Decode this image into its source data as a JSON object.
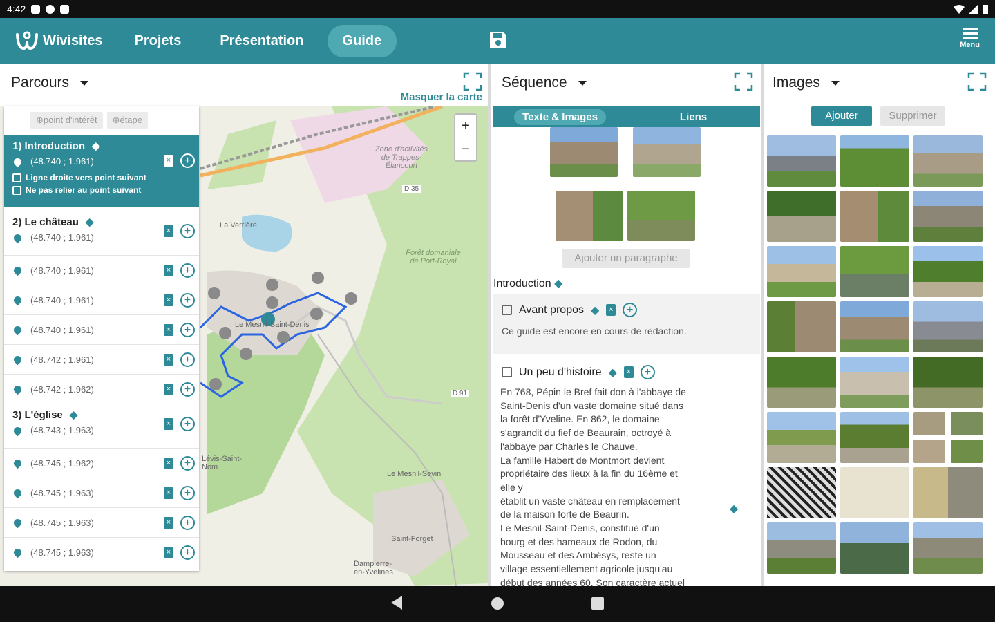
{
  "status_bar": {
    "time": "4:42"
  },
  "app_bar": {
    "logo": "Wivisites",
    "nav": [
      "Projets",
      "Présentation",
      "Guide"
    ],
    "active_nav": "Guide",
    "menu_label": "Menu"
  },
  "parcours": {
    "title": "Parcours",
    "hide_map": "Masquer la carte",
    "add_poi": "point d'intérêt",
    "add_step": "étape",
    "zoom_in": "+",
    "zoom_out": "−",
    "steps": [
      {
        "title": "1) Introduction",
        "coord": "(48.740 ; 1.961)",
        "opt1": "Ligne droite vers point suivant",
        "opt2": "Ne pas relier au point suivant"
      },
      {
        "title": "2) Le château",
        "coord": "(48.740 ; 1.961)"
      },
      {
        "title": "3) L'église",
        "coord": "(48.743 ; 1.963)"
      }
    ],
    "points_after_2": [
      "(48.740 ; 1.961)",
      "(48.740 ; 1.961)",
      "(48.740 ; 1.961)",
      "(48.742 ; 1.961)",
      "(48.742 ; 1.962)"
    ],
    "points_after_3": [
      "(48.745 ; 1.962)",
      "(48.745 ; 1.963)",
      "(48.745 ; 1.963)",
      "(48.745 ; 1.963)"
    ],
    "map_labels": [
      "Zone d'activités de Trappes-Élancourt",
      "Forêt domaniale de Port-Royal",
      "Le Mesnil-Saint-Denis",
      "Le Mesnil-Sevin",
      "Saint-Forget",
      "Dampierre-en-Yvelines",
      "Lévis-Saint-Nom",
      "La Verrière",
      "D 91",
      "D 35"
    ]
  },
  "sequence": {
    "title": "Séquence",
    "tabs": [
      "Texte & Images",
      "Liens"
    ],
    "add_paragraph": "Ajouter un paragraphe",
    "section": "Introduction",
    "card1_title": "Avant propos",
    "card1_text": "Ce guide est encore en cours de rédaction.",
    "card2_title": "Un peu d'histoire",
    "card2_lines": [
      "En 768, Pépin le Bref fait don à l'abbaye de",
      "Saint-Denis d'un vaste domaine situé dans",
      "la forêt d'Yveline. En 862, le domaine",
      "s'agrandit du fief de Beaurain, octroyé à",
      "l'abbaye par Charles le Chauve.",
      "La famille Habert de Montmort devient",
      "propriétaire des lieux à la fin du 16ème et",
      "elle y",
      "établit un vaste château en remplacement",
      "de la maison forte de Beaurin.",
      "Le Mesnil-Saint-Denis, constitué d'un",
      "bourg et des hameaux de Rodon, du",
      "Mousseau et des Ambésys, reste un",
      "village essentiellement agricole jusqu'au",
      "début des années 60. Son caractère actuel"
    ]
  },
  "images": {
    "title": "Images",
    "add": "Ajouter",
    "delete": "Supprimer"
  },
  "colors": {
    "accent": "#2e8a96",
    "accent_light": "#4ea9b3"
  }
}
